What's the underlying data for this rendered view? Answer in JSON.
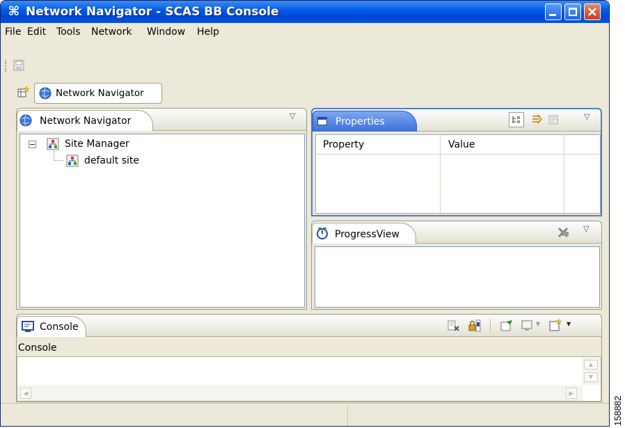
{
  "window": {
    "title": "Network Navigator - SCAS BB Console"
  },
  "menu": [
    {
      "label": "File"
    },
    {
      "label": "Edit"
    },
    {
      "label": "Tools"
    },
    {
      "label": "Network"
    },
    {
      "label": "Window"
    },
    {
      "label": "Help"
    }
  ],
  "perspective": {
    "label": "Network Navigator"
  },
  "navigator": {
    "tab_label": "Network Navigator",
    "tree": [
      {
        "label": "Site Manager",
        "expander": "⊟"
      },
      {
        "label": "default site"
      }
    ]
  },
  "properties": {
    "tab_label": "Properties",
    "columns": [
      "Property",
      "Value"
    ]
  },
  "progress": {
    "tab_label": "ProgressView"
  },
  "console": {
    "tab_label": "Console",
    "header": "Console"
  },
  "figure_id": "158882"
}
